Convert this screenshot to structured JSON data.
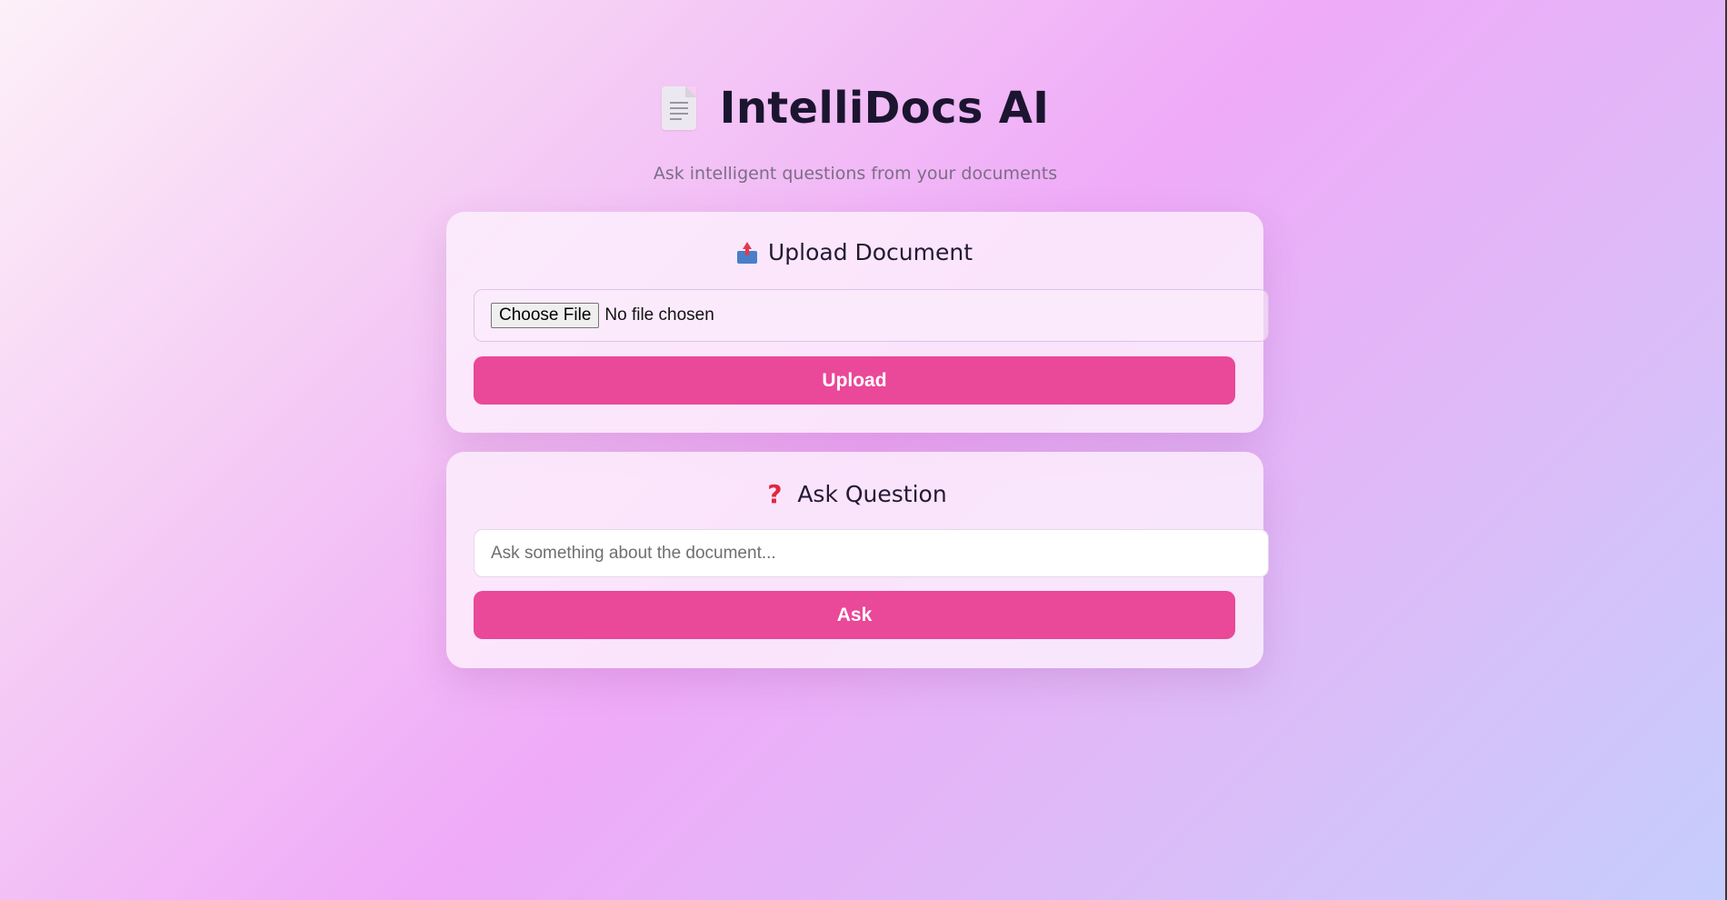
{
  "header": {
    "icon": "document-icon",
    "title": "IntelliDocs AI",
    "subtitle": "Ask intelligent questions from your documents"
  },
  "upload_card": {
    "icon": "outbox-tray-icon",
    "heading": "Upload Document",
    "file_button_label": "Choose File",
    "file_status": "No file chosen",
    "button_label": "Upload"
  },
  "ask_card": {
    "icon": "question-mark-icon",
    "heading": "Ask Question",
    "input_placeholder": "Ask something about the document...",
    "input_value": "",
    "button_label": "Ask"
  },
  "colors": {
    "accent": "#ea4898",
    "title": "#1c1530",
    "subtitle": "#7b6e86"
  }
}
